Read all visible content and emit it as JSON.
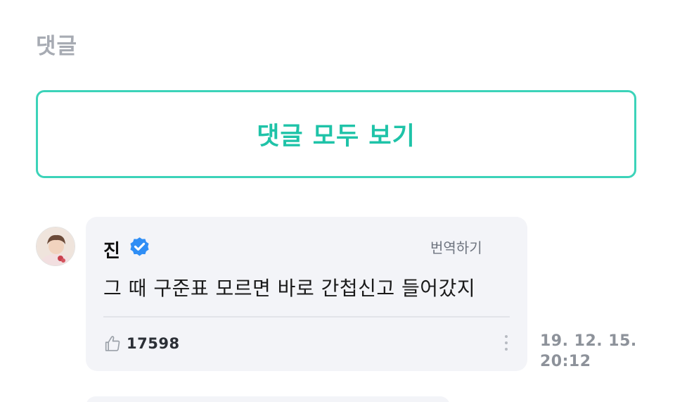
{
  "comments_section": {
    "title": "댓글",
    "view_all_label": "댓글 모두 보기"
  },
  "comment": {
    "author": "진",
    "verified": true,
    "translate_label": "번역하기",
    "text": "그 때 구준표 모르면 바로 간첩신고 들어갔지",
    "like_count": "17598",
    "date": "19. 12. 15.",
    "time": "20:12"
  },
  "icons": {
    "verified": "verified-badge-icon",
    "like": "thumbs-up-icon",
    "more": "more-vertical-icon"
  },
  "colors": {
    "accent": "#3cd3b9",
    "accent_text": "#1fc3a8",
    "verified_blue": "#2f8ef5",
    "card_background": "#f3f4f8",
    "muted_text": "#a7abb3"
  }
}
